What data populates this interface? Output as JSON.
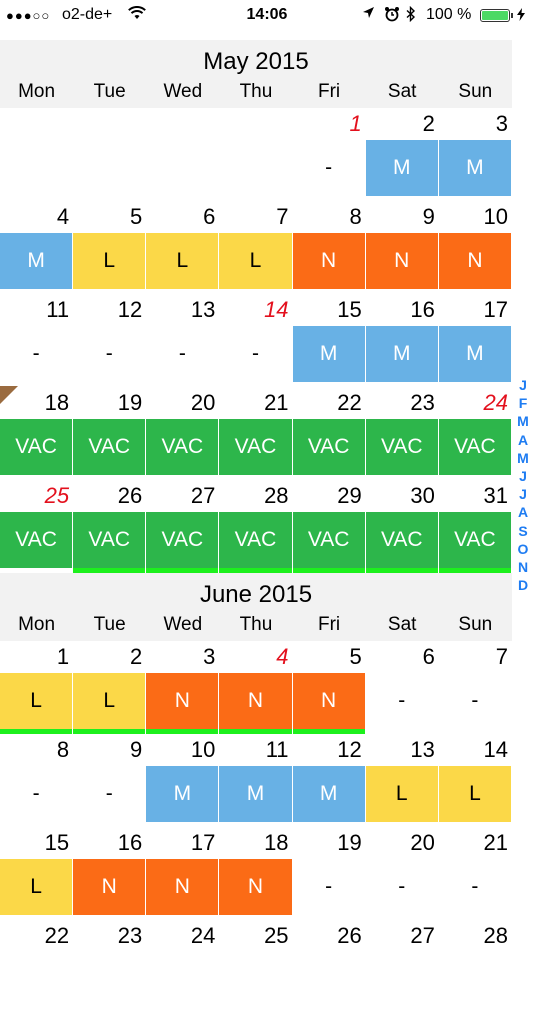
{
  "status_bar": {
    "signal": "●●●○○",
    "carrier": "o2-de+",
    "time": "14:06",
    "battery_percent": "100 %"
  },
  "weekday_labels": [
    "Mon",
    "Tue",
    "Wed",
    "Thu",
    "Fri",
    "Sat",
    "Sun"
  ],
  "months": [
    {
      "title": "May 2015",
      "weeks": [
        [
          null,
          null,
          null,
          null,
          {
            "day": "1",
            "shift": "-",
            "holiday": true
          },
          {
            "day": "2",
            "shift": "M"
          },
          {
            "day": "3",
            "shift": "M"
          }
        ],
        [
          {
            "day": "4",
            "shift": "M"
          },
          {
            "day": "5",
            "shift": "L"
          },
          {
            "day": "6",
            "shift": "L"
          },
          {
            "day": "7",
            "shift": "L"
          },
          {
            "day": "8",
            "shift": "N"
          },
          {
            "day": "9",
            "shift": "N"
          },
          {
            "day": "10",
            "shift": "N"
          }
        ],
        [
          {
            "day": "11",
            "shift": "-"
          },
          {
            "day": "12",
            "shift": "-"
          },
          {
            "day": "13",
            "shift": "-"
          },
          {
            "day": "14",
            "shift": "-",
            "holiday": true
          },
          {
            "day": "15",
            "shift": "M"
          },
          {
            "day": "16",
            "shift": "M"
          },
          {
            "day": "17",
            "shift": "M"
          }
        ],
        [
          {
            "day": "18",
            "shift": "VAC"
          },
          {
            "day": "19",
            "shift": "VAC"
          },
          {
            "day": "20",
            "shift": "VAC"
          },
          {
            "day": "21",
            "shift": "VAC"
          },
          {
            "day": "22",
            "shift": "VAC"
          },
          {
            "day": "23",
            "shift": "VAC"
          },
          {
            "day": "24",
            "shift": "VAC",
            "holiday": true
          }
        ],
        [
          {
            "day": "25",
            "shift": "VAC",
            "holiday": true
          },
          {
            "day": "26",
            "shift": "VAC",
            "bar": true
          },
          {
            "day": "27",
            "shift": "VAC",
            "bar": true
          },
          {
            "day": "28",
            "shift": "VAC",
            "bar": true
          },
          {
            "day": "29",
            "shift": "VAC",
            "bar": true
          },
          {
            "day": "30",
            "shift": "VAC",
            "bar": true
          },
          {
            "day": "31",
            "shift": "VAC",
            "bar": true
          }
        ]
      ]
    },
    {
      "title": "June 2015",
      "weeks": [
        [
          {
            "day": "1",
            "shift": "L",
            "bar": true
          },
          {
            "day": "2",
            "shift": "L",
            "bar": true
          },
          {
            "day": "3",
            "shift": "N",
            "bar": true
          },
          {
            "day": "4",
            "shift": "N",
            "holiday": true,
            "bar": true
          },
          {
            "day": "5",
            "shift": "N",
            "bar": true
          },
          {
            "day": "6",
            "shift": "-"
          },
          {
            "day": "7",
            "shift": "-"
          }
        ],
        [
          {
            "day": "8",
            "shift": "-"
          },
          {
            "day": "9",
            "shift": "-"
          },
          {
            "day": "10",
            "shift": "M"
          },
          {
            "day": "11",
            "shift": "M"
          },
          {
            "day": "12",
            "shift": "M"
          },
          {
            "day": "13",
            "shift": "L"
          },
          {
            "day": "14",
            "shift": "L"
          }
        ],
        [
          {
            "day": "15",
            "shift": "L"
          },
          {
            "day": "16",
            "shift": "N"
          },
          {
            "day": "17",
            "shift": "N"
          },
          {
            "day": "18",
            "shift": "N"
          },
          {
            "day": "19",
            "shift": "-"
          },
          {
            "day": "20",
            "shift": "-"
          },
          {
            "day": "21",
            "shift": "-"
          }
        ],
        [
          {
            "day": "22"
          },
          {
            "day": "23"
          },
          {
            "day": "24"
          },
          {
            "day": "25"
          },
          {
            "day": "26"
          },
          {
            "day": "27"
          },
          {
            "day": "28"
          }
        ]
      ]
    }
  ],
  "month_index": [
    "J",
    "F",
    "M",
    "A",
    "M",
    "J",
    "J",
    "A",
    "S",
    "O",
    "N",
    "D"
  ],
  "colors": {
    "M": "#68b1e5",
    "L": "#fbd848",
    "N": "#fb6b16",
    "VAC": "#2db64b",
    "holiday": "#e3101d",
    "bar": "#1df01d",
    "index": "#1e7cf2"
  }
}
